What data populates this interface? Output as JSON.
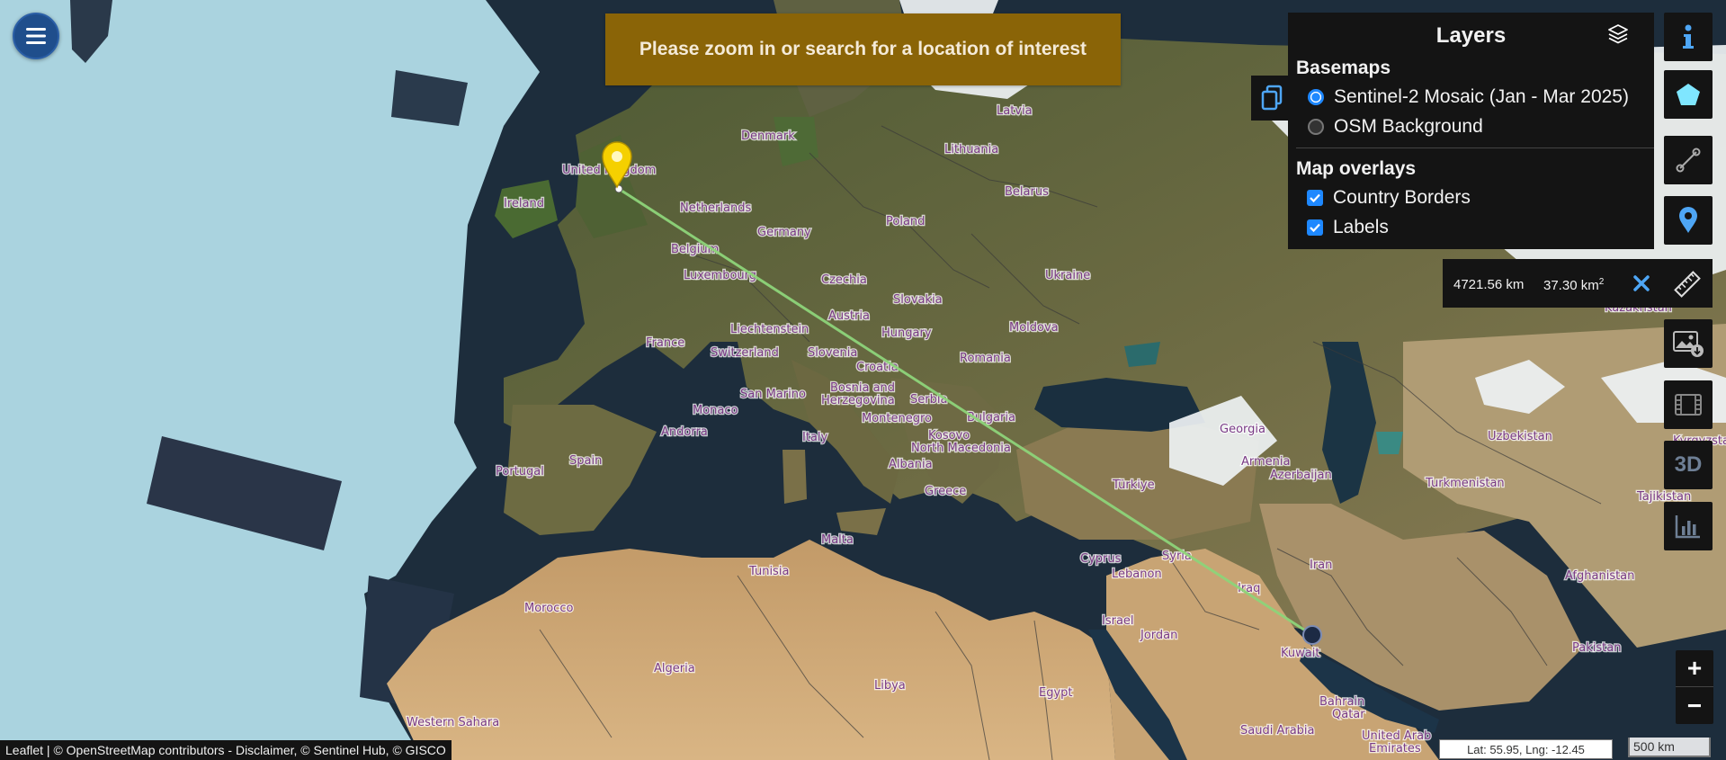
{
  "notice": {
    "text": "Please zoom in or search for a location of interest"
  },
  "layers": {
    "title": "Layers",
    "basemaps_title": "Basemaps",
    "basemaps": [
      {
        "label": "Sentinel-2 Mosaic (Jan - Mar 2025)",
        "selected": true
      },
      {
        "label": "OSM Background",
        "selected": false
      }
    ],
    "overlays_title": "Map overlays",
    "overlays": [
      {
        "label": "Country Borders",
        "checked": true
      },
      {
        "label": "Labels",
        "checked": true
      }
    ]
  },
  "measure": {
    "distance": "4721.56 km",
    "area_value": "37.30 km",
    "area_exp": "2"
  },
  "toolbar": {
    "items": [
      {
        "name": "info-icon"
      },
      {
        "name": "polygon-icon"
      },
      {
        "name": "line-draw-icon"
      },
      {
        "name": "location-pin-icon"
      },
      {
        "name": "ruler-icon"
      },
      {
        "name": "image-download-icon"
      },
      {
        "name": "film-icon"
      },
      {
        "name": "3d-icon",
        "label": "3D"
      },
      {
        "name": "chart-icon"
      }
    ]
  },
  "zoom": {
    "in": "+",
    "out": "−"
  },
  "attribution": "Leaflet | © OpenStreetMap contributors - Disclaimer, © Sentinel Hub, © GISCO",
  "coords": "Lat: 55.95, Lng: -12.45",
  "scale": "500 km",
  "map_labels": [
    "Latvia",
    "Denmark",
    "Lithuania",
    "United Kingdom",
    "Ireland",
    "Netherlands",
    "Belarus",
    "Germany",
    "Poland",
    "Belgium",
    "Luxembourg",
    "Ukraine",
    "Czechia",
    "Slovakia",
    "Austria",
    "Liechtenstein",
    "Hungary",
    "Moldova",
    "France",
    "Switzerland",
    "Slovenia",
    "Romania",
    "Croatia",
    "Bosnia and",
    "Herzegovina",
    "Serbia",
    "San Marino",
    "Montenegro",
    "Bulgaria",
    "Monaco",
    "Kosovo",
    "North Macedonia",
    "Andorra",
    "Italy",
    "Albania",
    "Portugal",
    "Spain",
    "Greece",
    "Türkiye",
    "Georgia",
    "Armenia",
    "Azerbaijan",
    "Uzbekistan",
    "Kazakhstan",
    "Kyrgyzstan",
    "Turkmenistan",
    "Tajikistan",
    "Malta",
    "Tunisia",
    "Cyprus",
    "Syria",
    "Lebanon",
    "Iraq",
    "Iran",
    "Afghanistan",
    "Morocco",
    "Israel",
    "Jordan",
    "Kuwait",
    "Pakistan",
    "Algeria",
    "Libya",
    "Egypt",
    "Bahrain",
    "Qatar",
    "Saudi Arabia",
    "Western Sahara",
    "United Arab",
    "Emirates"
  ],
  "colors": {
    "accent": "#1e88ff",
    "notice_bg": "#8a6407",
    "panel_bg": "#141414",
    "route_line": "#8ed47a",
    "pin": "#f5d000"
  }
}
